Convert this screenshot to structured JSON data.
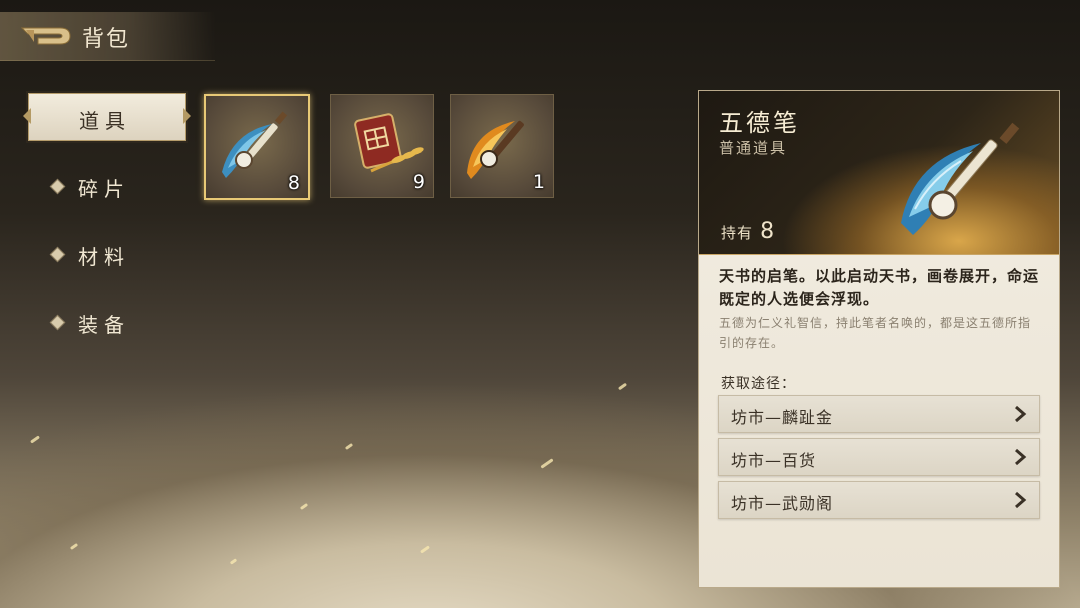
{
  "header": {
    "title": "背包",
    "back_icon": "back-arrow-icon"
  },
  "tabs": [
    {
      "label": "道具",
      "active": true
    },
    {
      "label": "碎片",
      "active": false
    },
    {
      "label": "材料",
      "active": false
    },
    {
      "label": "装备",
      "active": false
    }
  ],
  "items": [
    {
      "icon": "brush-blue-icon",
      "count": "8",
      "selected": true
    },
    {
      "icon": "field-seal-wheat-icon",
      "count": "9",
      "selected": false
    },
    {
      "icon": "brush-fire-icon",
      "count": "1",
      "selected": false
    }
  ],
  "detail": {
    "name": "五德笔",
    "type": "普通道具",
    "hold_label": "持有",
    "hold_count": "8",
    "description": "天书的启笔。以此启动天书，画卷展开，命运既定的人选便会浮现。",
    "lore": "五德为仁义礼智信，持此笔者名唤的，都是这五德所指引的存在。",
    "source_label": "获取途径：",
    "sources": [
      "坊市—麟趾金",
      "坊市—百货",
      "坊市—武勋阁"
    ]
  },
  "colors": {
    "accent_gold": "#e8c976",
    "panel_bg": "#f2ede2",
    "text_dark": "#2b241b"
  }
}
